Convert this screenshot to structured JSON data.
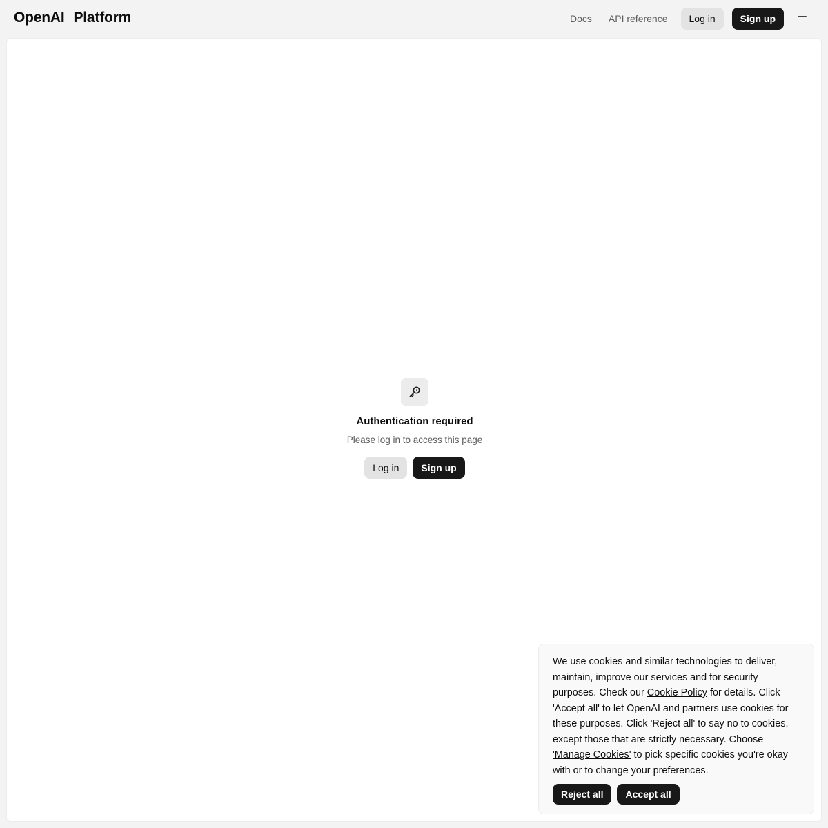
{
  "header": {
    "brand_openai": "OpenAI",
    "brand_platform": "Platform",
    "nav": {
      "docs": "Docs",
      "api_reference": "API reference",
      "login": "Log in",
      "signup": "Sign up"
    },
    "menu_icon": "menu-icon"
  },
  "auth": {
    "icon": "key-icon",
    "title": "Authentication required",
    "subtitle": "Please log in to access this page",
    "login": "Log in",
    "signup": "Sign up"
  },
  "cookie": {
    "text_1": "We use cookies and similar technologies to deliver, maintain, improve our services and for security purposes. Check our ",
    "policy_link": "Cookie Policy",
    "text_2": " for details. Click 'Accept all' to let OpenAI and partners use cookies for these purposes. Click 'Reject all' to say no to cookies, except those that are strictly necessary. Choose ",
    "manage_link": "'Manage Cookies'",
    "text_3": " to pick specific cookies you're okay with or to change your preferences.",
    "reject": "Reject all",
    "accept": "Accept all"
  },
  "colors": {
    "background": "#f3f3f3",
    "card": "#ffffff",
    "primary_button": "#181818",
    "secondary_button": "#e3e3e3",
    "muted_text": "#5d5d5d"
  }
}
